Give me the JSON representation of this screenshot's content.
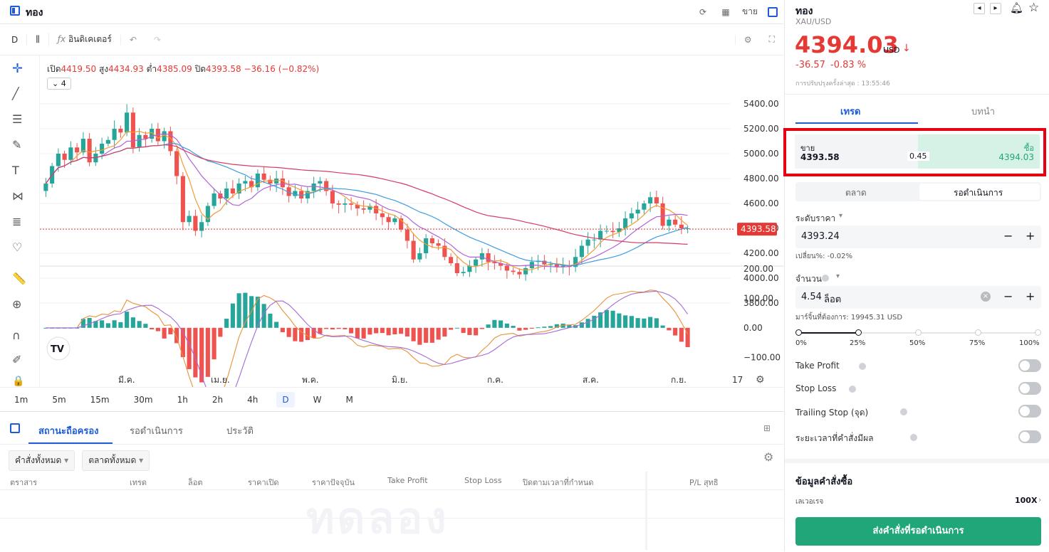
{
  "header": {
    "title": "ทอง",
    "side_label": "ขาย"
  },
  "chart_toolbar": {
    "timeframe": "D",
    "indicators_label": "อินดิเคเตอร์"
  },
  "ohlc": {
    "open_label": "เปิด",
    "open": "4419.50",
    "high_label": "สูง",
    "high": "4434.93",
    "low_label": "ต่ำ",
    "low": "4385.09",
    "close_label": "ปิด",
    "close": "4393.58",
    "change": "−36.16 (−0.82%)"
  },
  "indicator_count": "4",
  "chart_data": {
    "type": "candlestick",
    "price_axis_ticks": [
      "5400.00",
      "5200.00",
      "5000.00",
      "4800.00",
      "4600.00",
      "4400.00",
      "4200.00",
      "4000.00",
      "3800.00"
    ],
    "price_ylim": [
      3800,
      5400
    ],
    "current_price_label": "4393.58",
    "oscillator_ticks": [
      "200.00",
      "100.00",
      "0.00",
      "−100.00"
    ],
    "oscillator_ylim": [
      -150,
      200
    ],
    "time_labels": [
      "มี.ค.",
      "เม.ย.",
      "พ.ค.",
      "มิ.ย.",
      "ก.ค.",
      "ส.ค.",
      "ก.ย.",
      "17"
    ],
    "closes": [
      4760,
      4900,
      5000,
      4950,
      5050,
      5010,
      5120,
      4930,
      5000,
      5080,
      5110,
      5200,
      5170,
      5330,
      5050,
      5150,
      5120,
      5200,
      5100,
      5180,
      5020,
      4820,
      4450,
      4500,
      4380,
      4450,
      4580,
      4680,
      4640,
      4720,
      4680,
      4760,
      4780,
      4730,
      4840,
      4790,
      4760,
      4800,
      4730,
      4660,
      4700,
      4640,
      4700,
      4760,
      4780,
      4700,
      4600,
      4590,
      4600,
      4590,
      4560,
      4550,
      4580,
      4520,
      4490,
      4450,
      4480,
      4390,
      4300,
      4150,
      4200,
      4320,
      4280,
      4260,
      4170,
      4120,
      4040,
      4050,
      4100,
      4150,
      4200,
      4130,
      4120,
      4100,
      4060,
      4050,
      4030,
      4080,
      4130,
      4140,
      4110,
      4110,
      4090,
      4100,
      4090,
      4170,
      4260,
      4310,
      4310,
      4380,
      4380,
      4370,
      4400,
      4480,
      4520,
      4550,
      4600,
      4650,
      4600,
      4420,
      4470,
      4430,
      4400,
      4400
    ]
  },
  "timeframes": [
    "1m",
    "5m",
    "15m",
    "30m",
    "1h",
    "2h",
    "4h",
    "D",
    "W",
    "M"
  ],
  "active_timeframe": "D",
  "bottom": {
    "tabs": [
      "สถานะถือครอง",
      "รอดำเนินการ",
      "ประวัติ"
    ],
    "filters": [
      "คำสั่งทั้งหมด",
      "ตลาดทั้งหมด"
    ],
    "columns": [
      "ตราสาร",
      "เทรด",
      "ล็อต",
      "ราคาเปิด",
      "ราคาปัจจุบัน",
      "Take Profit",
      "Stop Loss",
      "ปิดตามเวลาที่กำหนด",
      "P/L สุทธิ"
    ],
    "watermark": "ทดลอง"
  },
  "panel": {
    "name": "ทอง",
    "symbol": "XAU/USD",
    "price": "4394.03",
    "currency": "USD",
    "change": "-36.57",
    "change_pct": "-0.83 %",
    "updated": "การปรับปรุงครั้งล่าสุด : 13:55:46",
    "tabs": [
      "เทรด",
      "บทนำ"
    ],
    "sell_label": "ขาย",
    "sell_price": "4393.58",
    "spread": "0.45",
    "buy_label": "ซื้อ",
    "buy_price": "4394.03",
    "order_types": [
      "ตลาด",
      "รอดำเนินการ"
    ],
    "price_level_label": "ระดับราคา",
    "price_level_value": "4393.24",
    "change_label": "เปลี่ยน%: -0.02%",
    "volume_label": "จำนวน",
    "volume_value": "4.54",
    "volume_unit": "ล็อต",
    "margin_label": "มาร์จิ้นที่ต้องการ: 19945.31 USD",
    "slider_labels": [
      "0%",
      "25%",
      "50%",
      "75%",
      "100%"
    ],
    "slider_value": 0.25,
    "toggles": [
      "Take Profit",
      "Stop Loss",
      "Trailing Stop (จุด)",
      "ระยะเวลาที่คำสั่งมีผล"
    ],
    "order_info_title": "ข้อมูลคำสั่งซื้อ",
    "leverage_label": "เลเวอเรจ",
    "leverage_value": "100X",
    "submit_label": "ส่งคำสั่งที่รอดำเนินการ"
  },
  "colors": {
    "up": "#26a69a",
    "down": "#ef5350",
    "accent": "#1e5bd7",
    "highlight_box": "#e60012",
    "submit": "#21a67a"
  }
}
